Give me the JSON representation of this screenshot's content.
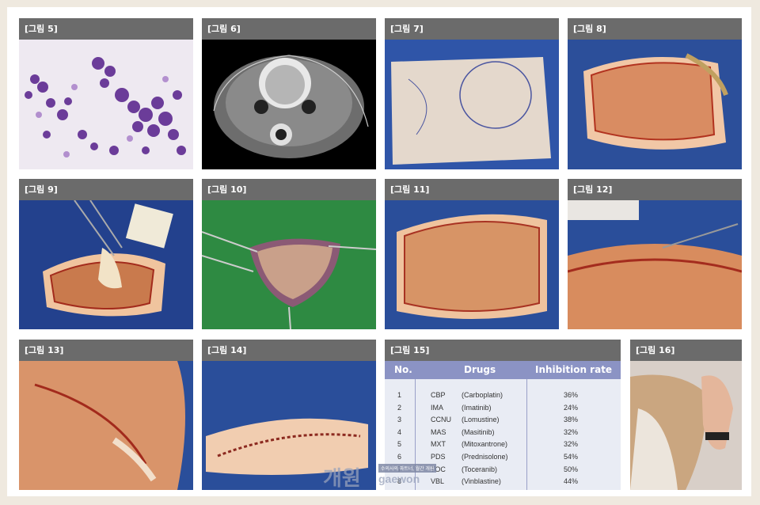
{
  "labels": [
    "[그림 5]",
    "[그림 6]",
    "[그림 7]",
    "[그림 8]",
    "[그림 9]",
    "[그림 10]",
    "[그림 11]",
    "[그림 12]",
    "[그림 13]",
    "[그림 14]",
    "[그림 15]",
    "[그림 16]"
  ],
  "table": {
    "headers": {
      "no": "No.",
      "drugs": "Drugs",
      "rate": "Inhibition rate"
    },
    "rows": [
      {
        "no": "1",
        "abbr": "CBP",
        "name": "(Carboplatin)",
        "rate": "36%"
      },
      {
        "no": "2",
        "abbr": "IMA",
        "name": "(Imatinib)",
        "rate": "24%"
      },
      {
        "no": "3",
        "abbr": "CCNU",
        "name": "(Lomustine)",
        "rate": "38%"
      },
      {
        "no": "4",
        "abbr": "MAS",
        "name": "(Masitinib)",
        "rate": "32%"
      },
      {
        "no": "5",
        "abbr": "MXT",
        "name": "(Mitoxantrone)",
        "rate": "32%"
      },
      {
        "no": "6",
        "abbr": "PDS",
        "name": "(Prednisolone)",
        "rate": "54%"
      },
      {
        "no": "7",
        "abbr": "TOC",
        "name": "(Toceranib)",
        "rate": "50%"
      },
      {
        "no": "8",
        "abbr": "VBL",
        "name": "(Vinblastine)",
        "rate": "44%"
      }
    ]
  },
  "watermark": {
    "main": "개원",
    "sub": "gaewon",
    "tag": "수의사의 파트너, 월간 개원"
  }
}
